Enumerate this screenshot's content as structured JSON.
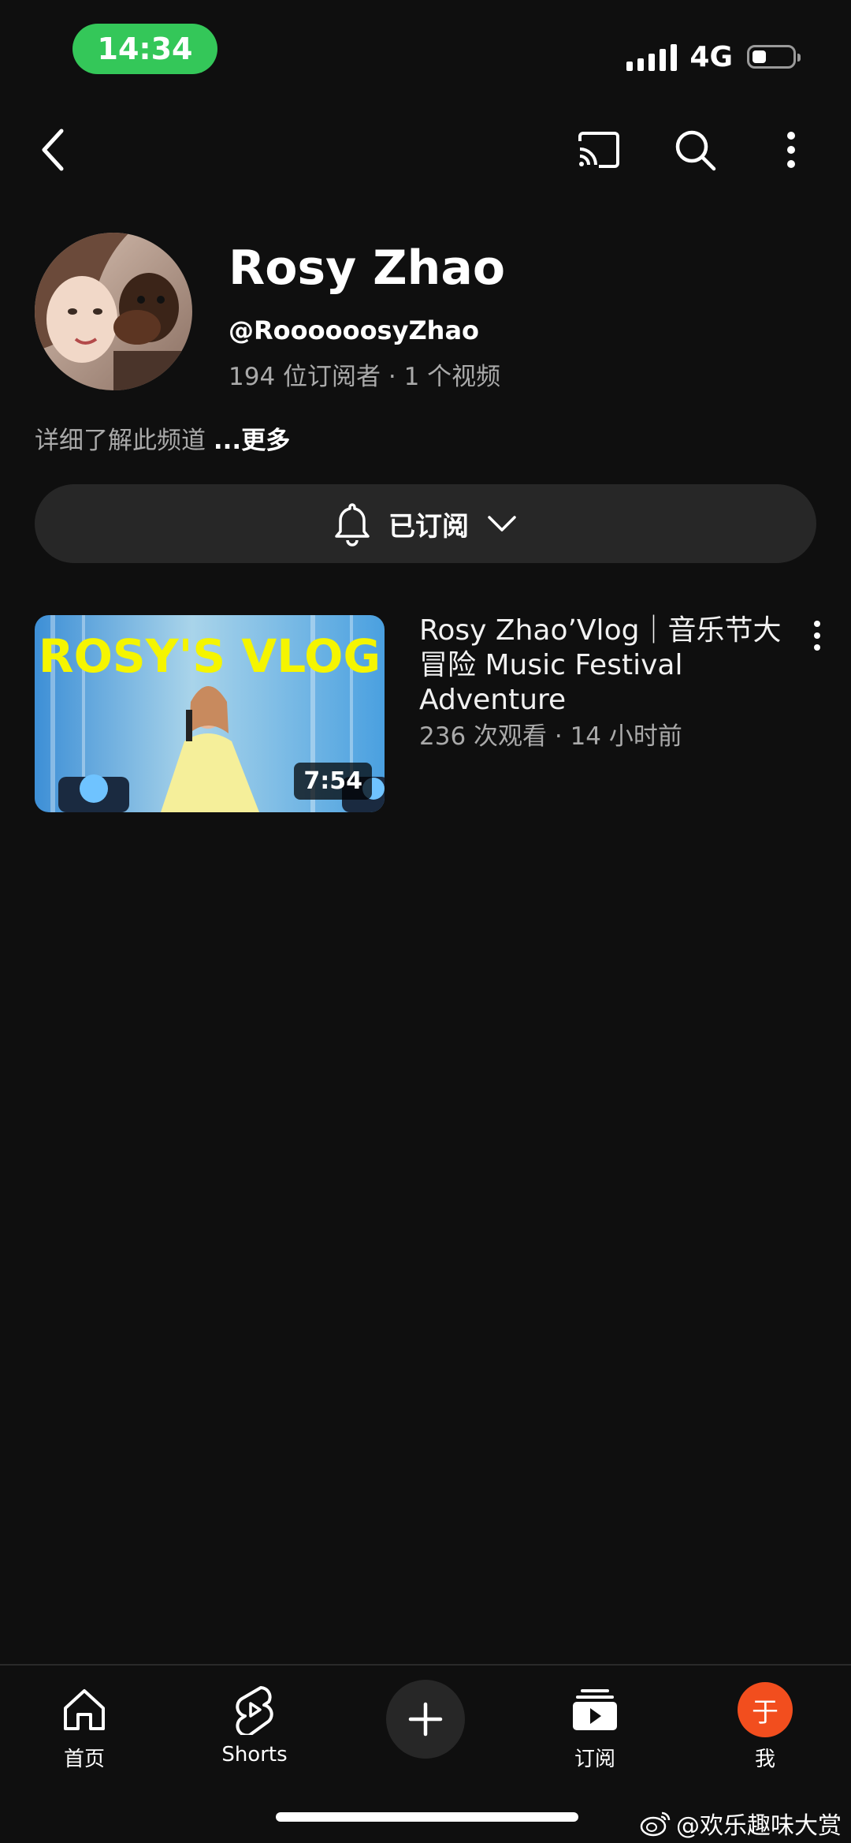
{
  "status_bar": {
    "time": "14:34",
    "network": "4G",
    "battery_level": 0.35
  },
  "top_bar": {
    "icons": [
      "back-icon",
      "cast-icon",
      "search-icon",
      "more-vertical-icon"
    ]
  },
  "channel": {
    "name": "Rosy Zhao",
    "handle": "@RoooooosyZhao",
    "stats": "194 位订阅者 · 1 个视频",
    "about_text": "详细了解此频道 ",
    "about_more": "...更多",
    "subscribe_label": "已订阅"
  },
  "video": {
    "thumbnail_text": "ROSY'S VLOG",
    "duration": "7:54",
    "title": "Rosy Zhao’Vlog｜音乐节大冒险 Music Festival Adventure",
    "meta": "236 次观看 · 14 小时前"
  },
  "bottom_nav": {
    "home": "首页",
    "shorts": "Shorts",
    "subscriptions": "订阅",
    "me": "我",
    "me_avatar_letter": "于"
  },
  "watermark": "@欢乐趣味大赏",
  "colors": {
    "background": "#0f0f0f",
    "surface": "#272727",
    "secondary_text": "#aaaaaa",
    "time_pill": "#34c759",
    "me_avatar": "#f24e1e",
    "thumbnail_text": "#f5f500"
  }
}
